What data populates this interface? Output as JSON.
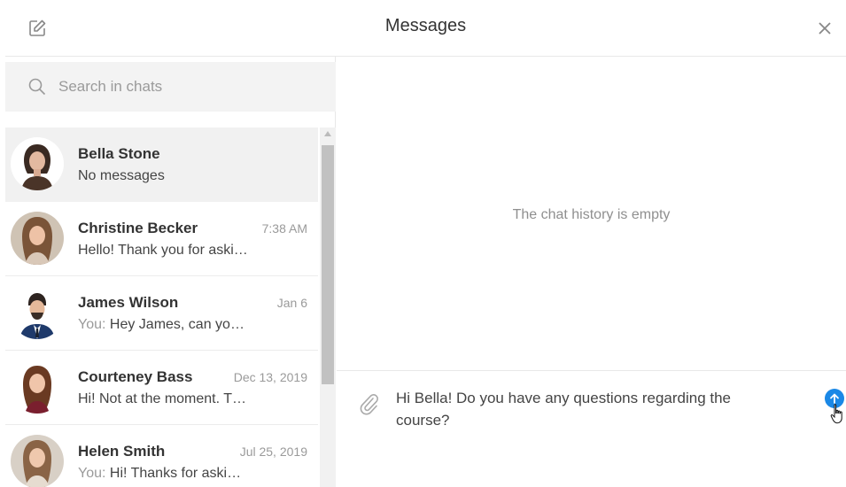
{
  "header": {
    "title": "Messages",
    "compose_icon": "edit-icon",
    "close_icon": "close-icon"
  },
  "search": {
    "placeholder": "Search in chats"
  },
  "chats": [
    {
      "name": "Bella Stone",
      "time": "",
      "prefix": "",
      "preview": "No messages",
      "active": true
    },
    {
      "name": "Christine Becker",
      "time": "7:38 AM",
      "prefix": "",
      "preview": "Hello! Thank you for aski…",
      "active": false
    },
    {
      "name": "James Wilson",
      "time": "Jan 6",
      "prefix": "You: ",
      "preview": "Hey James, can yo…",
      "active": false
    },
    {
      "name": "Courteney Bass",
      "time": "Dec 13, 2019",
      "prefix": "",
      "preview": "Hi! Not at the moment. T…",
      "active": false
    },
    {
      "name": "Helen Smith",
      "time": "Jul 25, 2019",
      "prefix": "You: ",
      "preview": "Hi! Thanks for aski…",
      "active": false
    }
  ],
  "conversation": {
    "empty_text": "The chat history is empty"
  },
  "composer": {
    "text": "Hi Bella! Do you have any questions regarding the course?"
  },
  "colors": {
    "accent": "#1a88e6",
    "active_row": "#f1f1f1",
    "search_bg": "#f3f3f3"
  }
}
